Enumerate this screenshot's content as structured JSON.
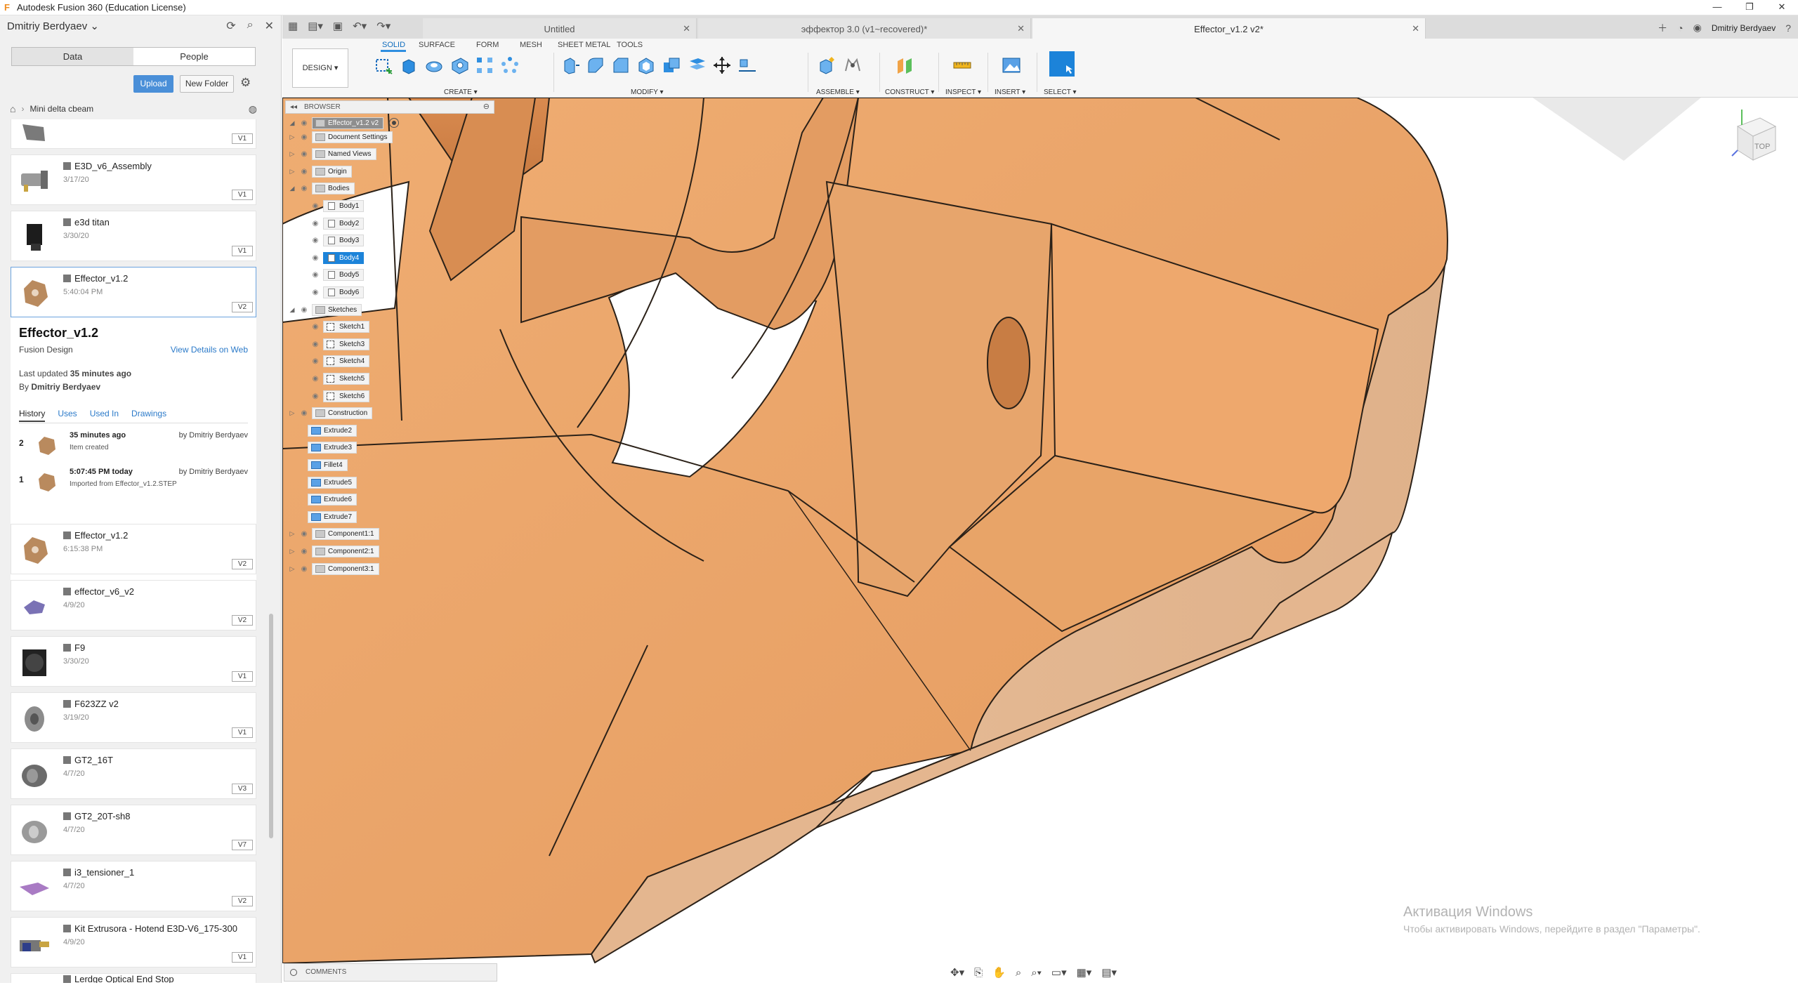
{
  "window": {
    "title": "Autodesk Fusion 360 (Education License)",
    "controls": [
      "—",
      "❐",
      "✕"
    ]
  },
  "data_panel": {
    "user": "Dmitriy Berdyaev",
    "tabs": [
      "Data",
      "People"
    ],
    "active_tab": "Data",
    "upload_label": "Upload",
    "new_folder_label": "New Folder",
    "project": "Mini delta cbeam",
    "files_top": [
      {
        "name": "",
        "date": "",
        "version": "V1"
      },
      {
        "name": "E3D_v6_Assembly",
        "date": "3/17/20",
        "version": "V1"
      },
      {
        "name": "e3d titan",
        "date": "3/30/20",
        "version": "V1"
      },
      {
        "name": "Effector_v1.2",
        "date": "5:40:04 PM",
        "version": "V2"
      }
    ],
    "detail": {
      "title": "Effector_v1.2",
      "subtitle": "Fusion Design",
      "view_link": "View Details on Web",
      "last_updated_label": "Last updated",
      "last_updated_value": "35 minutes ago",
      "by_label": "By",
      "by_value": "Dmitriy Berdyaev",
      "tabs": [
        "History",
        "Uses",
        "Used In",
        "Drawings"
      ],
      "history": [
        {
          "num": "2",
          "time": "35 minutes ago",
          "by": "by Dmitriy Berdyaev",
          "desc": "Item created"
        },
        {
          "num": "1",
          "time": "5:07:45 PM today",
          "by": "by Dmitriy Berdyaev",
          "desc": "Imported from Effector_v1.2.STEP"
        }
      ]
    },
    "files_bottom": [
      {
        "name": "Effector_v1.2",
        "date": "6:15:38 PM",
        "version": "V2"
      },
      {
        "name": "effector_v6_v2",
        "date": "4/9/20",
        "version": "V2"
      },
      {
        "name": "F9",
        "date": "3/30/20",
        "version": "V1"
      },
      {
        "name": "F623ZZ v2",
        "date": "3/19/20",
        "version": "V1"
      },
      {
        "name": "GT2_16T",
        "date": "4/7/20",
        "version": "V3"
      },
      {
        "name": "GT2_20T-sh8",
        "date": "4/7/20",
        "version": "V7"
      },
      {
        "name": "i3_tensioner_1",
        "date": "4/7/20",
        "version": "V2"
      },
      {
        "name": "Kit Extrusora - Hotend E3D-V6_175-300",
        "date": "4/9/20",
        "version": "V1"
      },
      {
        "name": "Lerdge Optical End Stop",
        "date": "",
        "version": ""
      }
    ]
  },
  "doc_tabs": [
    {
      "name": "Untitled",
      "active": false
    },
    {
      "name": "эффектор 3.0 (v1~recovered)*",
      "active": false
    },
    {
      "name": "Effector_v1.2 v2*",
      "active": true
    }
  ],
  "account_name": "Dmitriy Berdyaev",
  "toolbar": {
    "workspace": "DESIGN ▾",
    "tabs": [
      "SOLID",
      "SURFACE",
      "FORM",
      "MESH",
      "SHEET METAL",
      "TOOLS"
    ],
    "active_tab": "SOLID",
    "groups": [
      "CREATE ▾",
      "MODIFY ▾",
      "ASSEMBLE ▾",
      "CONSTRUCT ▾",
      "INSPECT ▾",
      "INSERT ▾",
      "SELECT ▾"
    ]
  },
  "browser": {
    "header": "BROWSER",
    "root": "Effector_v1.2 v2",
    "nodes": [
      {
        "label": "Document Settings",
        "kind": "gear"
      },
      {
        "label": "Named Views",
        "kind": "folder"
      },
      {
        "label": "Origin",
        "kind": "folder"
      },
      {
        "label": "Bodies",
        "kind": "folder"
      },
      {
        "label": "Body1",
        "kind": "body"
      },
      {
        "label": "Body2",
        "kind": "body"
      },
      {
        "label": "Body3",
        "kind": "body"
      },
      {
        "label": "Body4",
        "kind": "body",
        "highlight": true
      },
      {
        "label": "Body5",
        "kind": "body"
      },
      {
        "label": "Body6",
        "kind": "body"
      },
      {
        "label": "Sketches",
        "kind": "folder"
      },
      {
        "label": "Sketch1",
        "kind": "sketch"
      },
      {
        "label": "Sketch3",
        "kind": "sketch"
      },
      {
        "label": "Sketch4",
        "kind": "sketch"
      },
      {
        "label": "Sketch5",
        "kind": "sketch"
      },
      {
        "label": "Sketch6",
        "kind": "sketch"
      },
      {
        "label": "Construction",
        "kind": "folder"
      },
      {
        "label": "Extrude2",
        "kind": "feature"
      },
      {
        "label": "Extrude3",
        "kind": "feature"
      },
      {
        "label": "Fillet4",
        "kind": "feature"
      },
      {
        "label": "Extrude5",
        "kind": "feature"
      },
      {
        "label": "Extrude6",
        "kind": "feature"
      },
      {
        "label": "Extrude7",
        "kind": "feature"
      },
      {
        "label": "Component1:1",
        "kind": "component"
      },
      {
        "label": "Component2:1",
        "kind": "component"
      },
      {
        "label": "Component3:1",
        "kind": "component"
      }
    ]
  },
  "comments_label": "COMMENTS",
  "viewcube_label": "TOP",
  "watermark": {
    "line1": "Активация Windows",
    "line2": "Чтобы активировать Windows, перейдите в раздел \"Параметры\"."
  },
  "colors": {
    "accent": "#1c83d9",
    "model_face": "#eaa26c",
    "model_side": "#e3b48f",
    "model_edge": "#2b2118"
  }
}
